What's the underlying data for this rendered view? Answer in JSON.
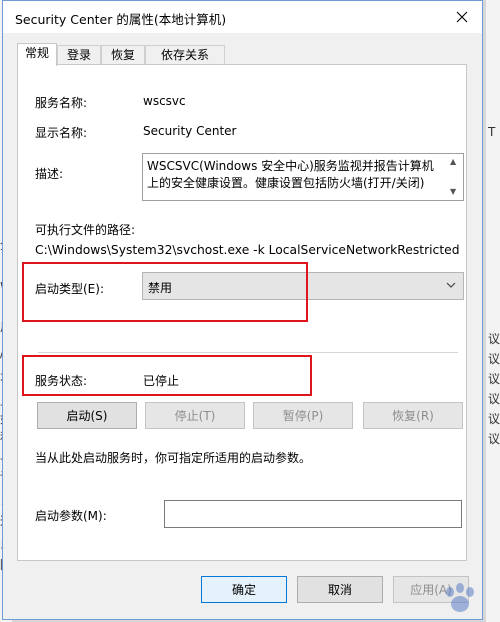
{
  "window": {
    "title": "Security Center 的属性(本地计算机)",
    "close_icon": "close-icon"
  },
  "tabs": [
    {
      "label": "常规",
      "active": true
    },
    {
      "label": "登录"
    },
    {
      "label": "恢复"
    },
    {
      "label": "依存关系"
    }
  ],
  "general": {
    "service_name_label": "服务名称:",
    "service_name_value": "wscsvc",
    "display_name_label": "显示名称:",
    "display_name_value": "Security Center",
    "description_label": "描述:",
    "description_value": "WSCSVC(Windows 安全中心)服务监视并报告计算机上的安全健康设置。健康设置包括防火墙(打开/关闭)",
    "path_label": "可执行文件的路径:",
    "path_value": "C:\\Windows\\System32\\svchost.exe -k LocalServiceNetworkRestricted",
    "startup_type_label": "启动类型(E):",
    "startup_type_value": "禁用",
    "service_status_label": "服务状态:",
    "service_status_value": "已停止",
    "buttons": {
      "start": "启动(S)",
      "stop": "停止(T)",
      "pause": "暂停(P)",
      "resume": "恢复(R)"
    },
    "hint_text": "当从此处启动服务时，你可指定所适用的启动参数。",
    "start_params_label": "启动参数(M):",
    "start_params_value": ""
  },
  "footer": {
    "ok": "确定",
    "cancel": "取消",
    "apply": "应用(A)"
  },
  "background_chars": {
    "left": [
      "全",
      "w",
      "用",
      "/",
      "不",
      "止",
      "如",
      "和",
      "止",
      "请",
      "，",
      "通",
      "以",
      "阮"
    ],
    "right": [
      "T",
      "议",
      "议",
      "议",
      "议",
      "议",
      "议"
    ]
  },
  "colors": {
    "highlight": "#e0151b",
    "primary_border": "#0078d7",
    "window_border": "#6f9ad3"
  }
}
